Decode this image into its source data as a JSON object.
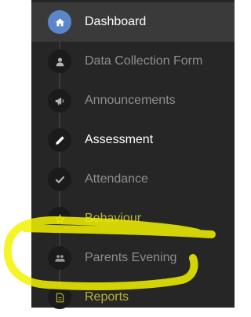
{
  "nav": {
    "items": [
      {
        "label": "Dashboard",
        "icon": "home-icon",
        "active": true
      },
      {
        "label": "Data Collection Form",
        "icon": "user-icon",
        "active": false
      },
      {
        "label": "Announcements",
        "icon": "bullhorn-icon",
        "active": false
      },
      {
        "label": "Assessment",
        "icon": "pencil-icon",
        "active": false
      },
      {
        "label": "Attendance",
        "icon": "check-icon",
        "active": false
      },
      {
        "label": "Behaviour",
        "icon": "star-icon",
        "active": false
      },
      {
        "label": "Parents Evening",
        "icon": "group-icon",
        "active": false
      },
      {
        "label": "Reports",
        "icon": "document-icon",
        "active": false
      }
    ]
  },
  "colors": {
    "sidebar_bg": "#262626",
    "active_bg": "#3a3a3a",
    "active_icon": "#5b86c9",
    "annotation": "#ffff00"
  }
}
